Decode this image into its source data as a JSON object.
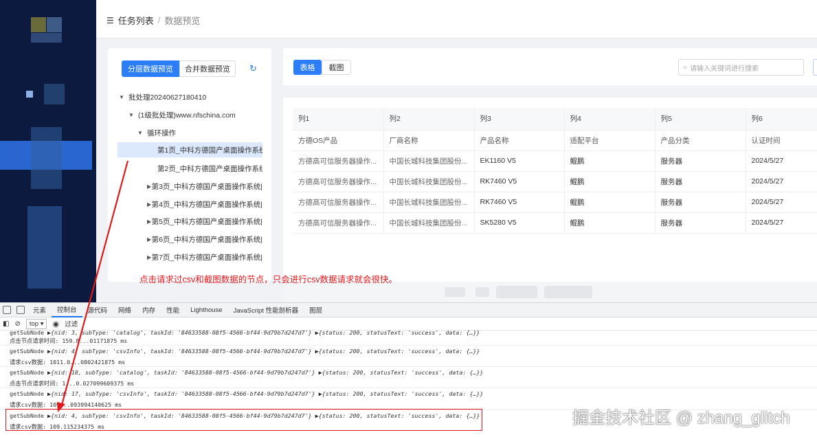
{
  "breadcrumb": {
    "root": "任务列表",
    "separator": "/",
    "current": "数据预览"
  },
  "tree_panel": {
    "mode_tabs": [
      "分层数据预览",
      "合并数据预览"
    ],
    "nodes": [
      {
        "label": "批处理20240627180410",
        "expanded": true
      },
      {
        "label": "(1级批处理)www.nfschina.com",
        "expanded": true
      },
      {
        "label": "循环操作",
        "expanded": true
      },
      {
        "label": "第1页_中科方德国产桌面操作系统|",
        "selected": true
      },
      {
        "label": "第2页_中科方德国产桌面操作系统|"
      },
      {
        "label": "第3页_中科方德国产桌面操作系统|"
      },
      {
        "label": "第4页_中科方德国产桌面操作系统|"
      },
      {
        "label": "第5页_中科方德国产桌面操作系统|"
      },
      {
        "label": "第6页_中科方德国产桌面操作系统|"
      },
      {
        "label": "第7页_中科方德国产桌面操作系统|"
      }
    ]
  },
  "content": {
    "view_tabs": [
      "表格",
      "截图"
    ],
    "search_placeholder": "请输入关键词进行搜索",
    "table": {
      "headers": [
        "列1",
        "列2",
        "列3",
        "列4",
        "列5",
        "列6"
      ],
      "subheaders": [
        "方德OS产品",
        "厂商名称",
        "产品名称",
        "适配平台",
        "产品分类",
        "认证时间"
      ],
      "rows": [
        [
          "方德高可信服务器操作...",
          "中国长城科技集团股份...",
          "EK1160 V5",
          "鲲鹏",
          "服务器",
          "2024/5/27"
        ],
        [
          "方德高可信服务器操作...",
          "中国长城科技集团股份...",
          "RK7460 V5",
          "鲲鹏",
          "服务器",
          "2024/5/27"
        ],
        [
          "方德高可信服务器操作...",
          "中国长城科技集团股份...",
          "RK7460 V5",
          "鲲鹏",
          "服务器",
          "2024/5/27"
        ],
        [
          "方德高可信服务器操作...",
          "中国长城科技集团股份...",
          "SK5280 V5",
          "鲲鹏",
          "服务器",
          "2024/5/27"
        ]
      ]
    }
  },
  "annotation": "点击请求过csv和截图数据的节点，只会进行csv数据请求就会很快。",
  "devtools": {
    "tabs": [
      "元素",
      "控制台",
      "源代码",
      "网络",
      "内存",
      "性能",
      "Lighthouse",
      "JavaScript 性能剖析器",
      "图层"
    ],
    "active_tab": "控制台",
    "context": "top ▾",
    "filter": "过滤",
    "logs": [
      {
        "prefix": "getSubNode",
        "args": "{nid: 3, subType: 'catalog', taskId: '84633588-08f5-4566-bf44-9d79b7d247d7'}",
        "response": "{status: 200, statusText: 'success', data: {…}}"
      },
      {
        "prefix": "点击节点请求时间:",
        "value": "159.8...01171875 ms"
      },
      {
        "prefix": "getSubNode",
        "args": "{nid: 4, subType: 'csvInfo', taskId: '84633588-08f5-4566-bf44-9d79b7d247d7'}",
        "response": "{status: 200, statusText: 'success', data: {…}}"
      },
      {
        "prefix": "请求csv数据:",
        "value": "1011.0...0802421875 ms"
      },
      {
        "prefix": "getSubNode",
        "args": "{nid: 18, subType: 'catalog', taskId: '84633588-08f5-4566-bf44-9d79b7d247d7'}",
        "response": "{status: 200, statusText: 'success', data: {…}}"
      },
      {
        "prefix": "点击节点请求时间:",
        "value": "1...0.027099609375 ms"
      },
      {
        "prefix": "getSubNode",
        "args": "{nid: 17, subType: 'csvInfo', taskId: '84633588-08f5-4566-bf44-9d79b7d247d7'}",
        "response": "{status: 200, statusText: 'success', data: {…}}"
      },
      {
        "prefix": "请求csv数据:",
        "value": "109...093994140625 ms"
      },
      {
        "prefix": "getSubNode",
        "args": "{nid: 4, subType: 'csvInfo', taskId: '84633588-08f5-4566-bf44-9d79b7d247d7'}",
        "response": "{status: 200, statusText: 'success', data: {…}}"
      },
      {
        "prefix": "请求csv数据:",
        "value": "109.115234375 ms"
      }
    ]
  },
  "watermark": "掘金技术社区 @ zhang_glitch",
  "colors": {
    "primary": "#2c7ef8",
    "annotation_red": "#e0191c",
    "sidebar": "#0b1a3e"
  }
}
